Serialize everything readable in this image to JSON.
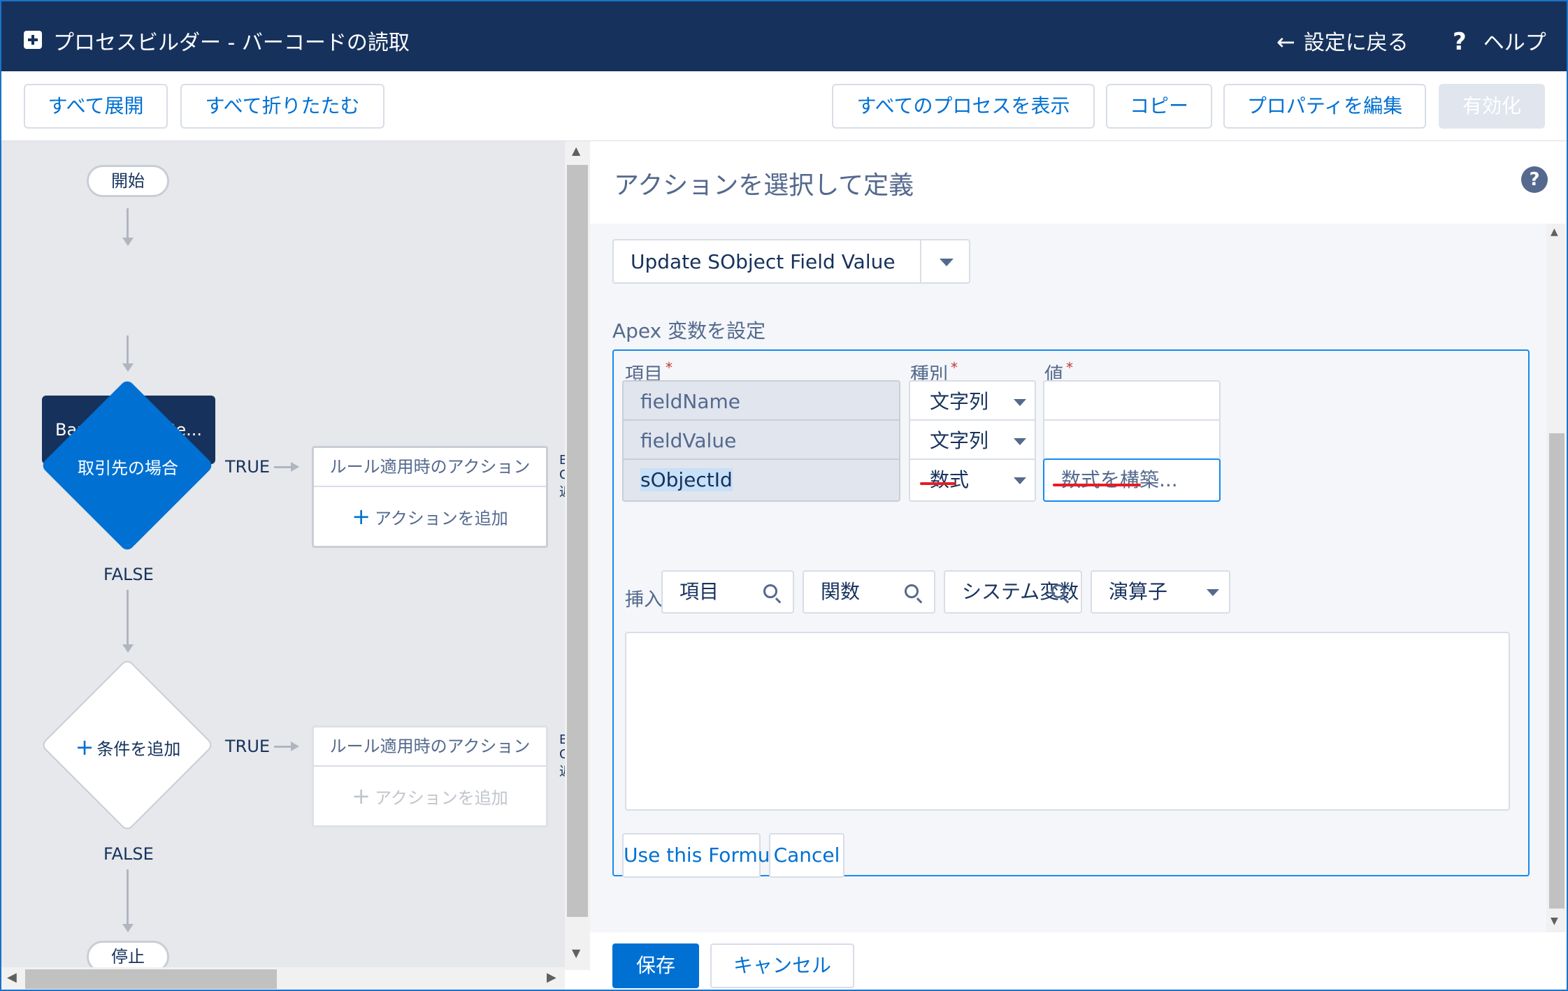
{
  "header": {
    "title": "プロセスビルダー - バーコードの読取",
    "back_label": "設定に戻る",
    "help_label": "ヘルプ"
  },
  "toolbar": {
    "expand_all": "すべて展開",
    "collapse_all": "すべて折りたたむ",
    "view_all_processes": "すべてのプロセスを表示",
    "copy": "コピー",
    "edit_properties": "プロパティを編集",
    "activate": "有効化"
  },
  "canvas": {
    "start_label": "開始",
    "object_node": "BarcodeScanRe...",
    "criteria1": {
      "label": "取引先の場合",
      "true_label": "TRUE",
      "false_label": "FALSE",
      "action_header": "ルール適用時のアクション",
      "add_action": "アクションを追加"
    },
    "criteria2": {
      "label": "条件を追加",
      "true_label": "TRUE",
      "false_label": "FALSE",
      "action_header": "ルール適用時のアクション",
      "add_action": "アクションを追加"
    },
    "stop_label": "停止"
  },
  "panel": {
    "title": "アクションを選択して定義",
    "selected_action": "Update SObject Field Value",
    "section_label": "Apex 変数を設定",
    "columns": {
      "field": "項目",
      "type": "種別",
      "value": "値",
      "required_mark": "*"
    },
    "rows": [
      {
        "field": "fieldName",
        "type": "文字列",
        "value": ""
      },
      {
        "field": "fieldValue",
        "type": "文字列",
        "value": ""
      },
      {
        "field": "sObjectId",
        "type": "数式",
        "value": "数式を構築..."
      }
    ],
    "insert": {
      "label": "挿入:",
      "field_picker": "項目",
      "function_picker": "関数",
      "system_var_picker": "システム変数",
      "operator_picker": "演算子"
    },
    "formula_text": "",
    "use_formula_button": "Use this Formula",
    "cancel_formula_button": "Cancel",
    "save_button": "保存",
    "cancel_button": "キャンセル"
  },
  "colors": {
    "header_bg": "#16325c",
    "accent": "#0070d2",
    "highlight_underline": "#e31e24"
  }
}
